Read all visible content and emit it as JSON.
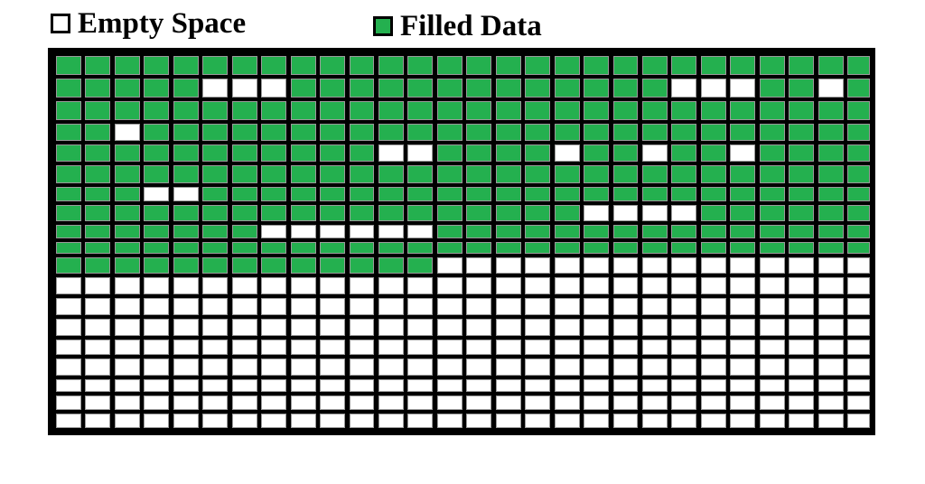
{
  "legend": {
    "items": [
      {
        "key": "empty",
        "label": "Empty Space",
        "color": "#ffffff"
      },
      {
        "key": "filled",
        "label": "Filled Data",
        "color": "#24b04f"
      }
    ]
  },
  "grid": {
    "columns": 28,
    "rows": 19,
    "filled_color": "#24b04f",
    "empty_color": "#ffffff",
    "line_color": "#000000",
    "filled_rows_count": 11,
    "partial_row": {
      "row": 10,
      "filled_columns": 13
    },
    "empty_cells_within_filled_region": [
      {
        "row": 1,
        "cols": [
          5,
          6,
          7,
          21,
          22,
          23,
          26
        ]
      },
      {
        "row": 3,
        "cols": [
          2
        ]
      },
      {
        "row": 4,
        "cols": [
          11,
          12,
          17,
          20,
          23
        ]
      },
      {
        "row": 6,
        "cols": [
          3,
          4
        ]
      },
      {
        "row": 7,
        "cols": [
          18,
          19,
          20,
          21
        ]
      },
      {
        "row": 8,
        "cols": [
          7,
          8,
          9,
          10,
          11,
          12
        ]
      }
    ]
  }
}
